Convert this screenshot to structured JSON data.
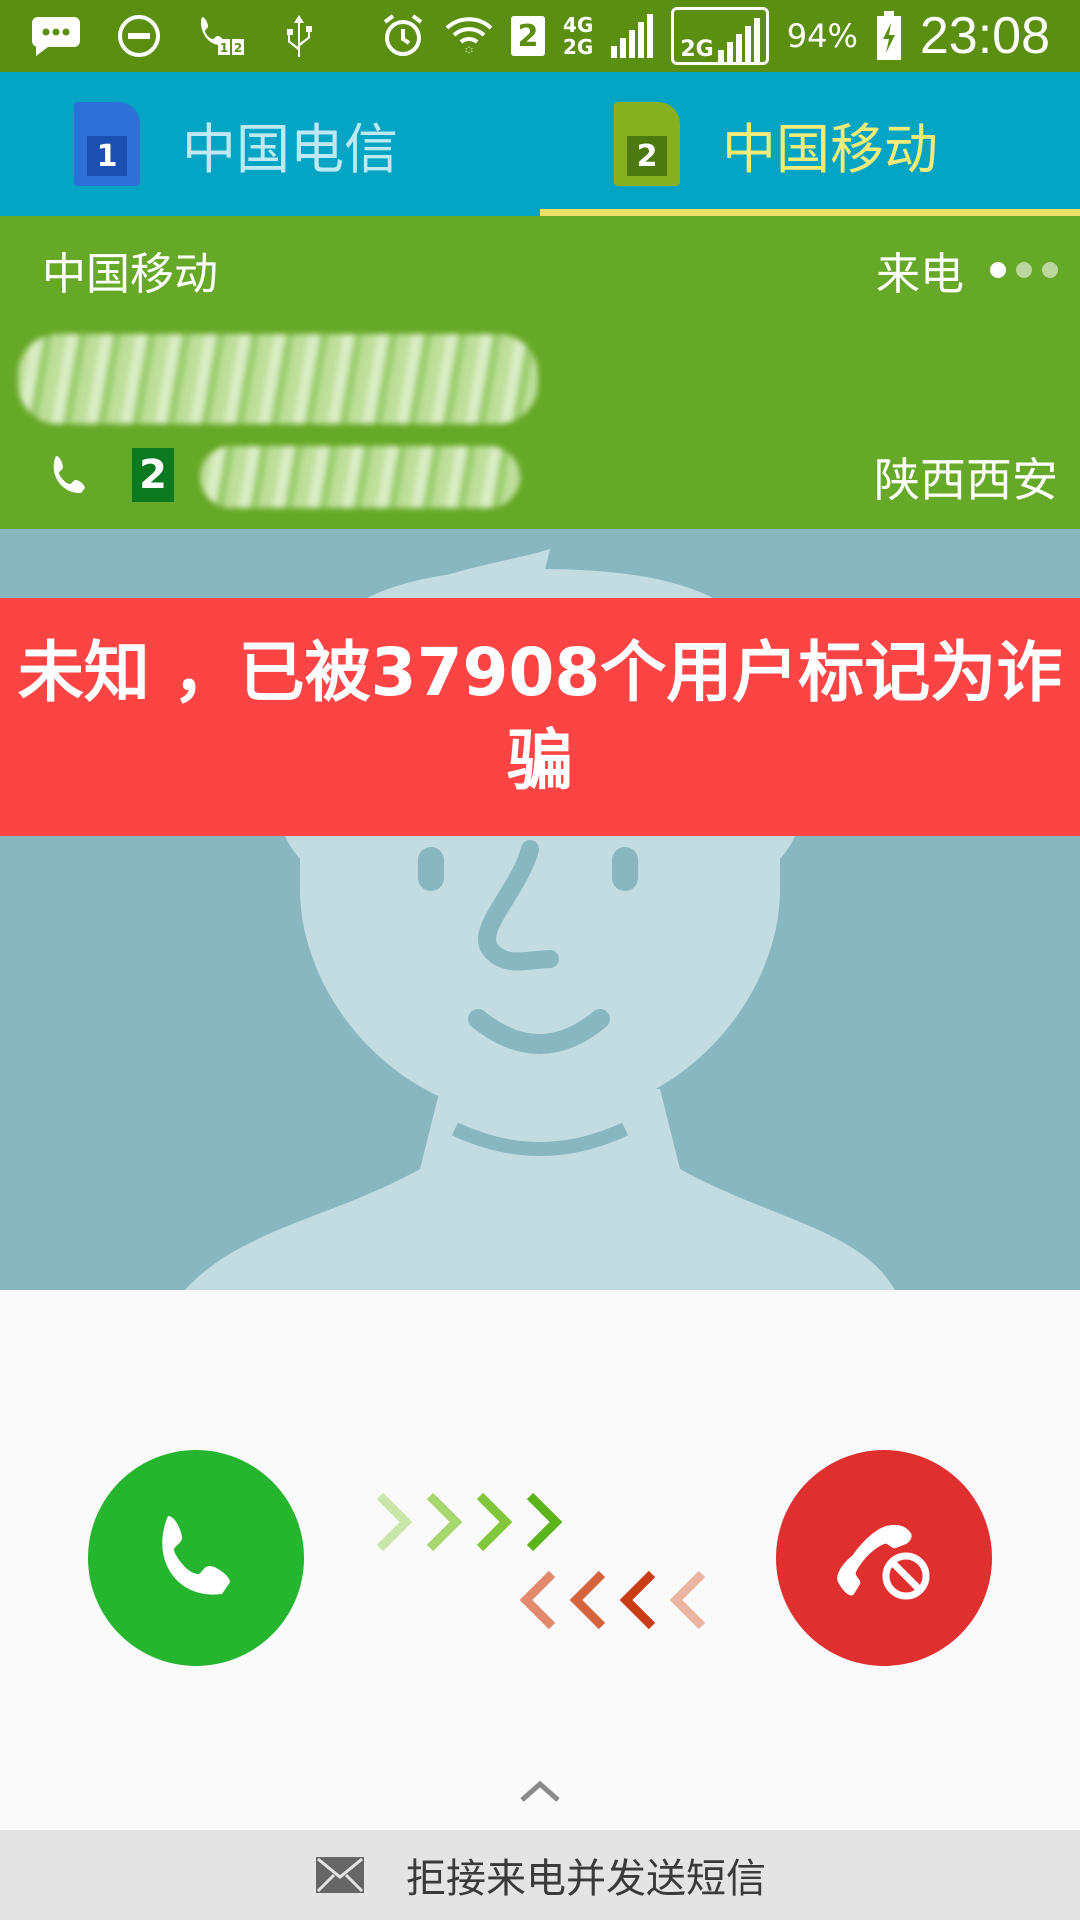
{
  "status_bar": {
    "sim2_indicator": "2",
    "net_top": "4G",
    "net_bottom": "2G",
    "net_box_label": "2G",
    "battery_percent": "94%",
    "time": "23:08",
    "icons": [
      "chat-bubble-icon",
      "do-not-disturb-icon",
      "dual-sim-call-icon",
      "usb-icon",
      "alarm-icon",
      "wifi-icon",
      "signal-icon",
      "battery-charging-icon"
    ]
  },
  "sim_tabs": {
    "items": [
      {
        "badge": "1",
        "label": "中国电信"
      },
      {
        "badge": "2",
        "label": "中国移动"
      }
    ],
    "selected_index": 1
  },
  "caller": {
    "carrier": "中国移动",
    "status": "来电",
    "sim_badge": "2",
    "location": "陕西西安"
  },
  "warning": {
    "text": "未知 ，已被37908个用户标记为诈骗"
  },
  "actions": {
    "answer": "answer-call",
    "reject": "reject-call"
  },
  "sms_bar": {
    "label": "拒接来电并发送短信"
  },
  "colors": {
    "status_bar": "#5a8f12",
    "sim_tab_bg": "#04a4c4",
    "caller_panel": "#66a827",
    "avatar_bg": "#88b7bf",
    "warning": "#fd4444",
    "answer": "#25b52f",
    "reject": "#df2f2f"
  }
}
